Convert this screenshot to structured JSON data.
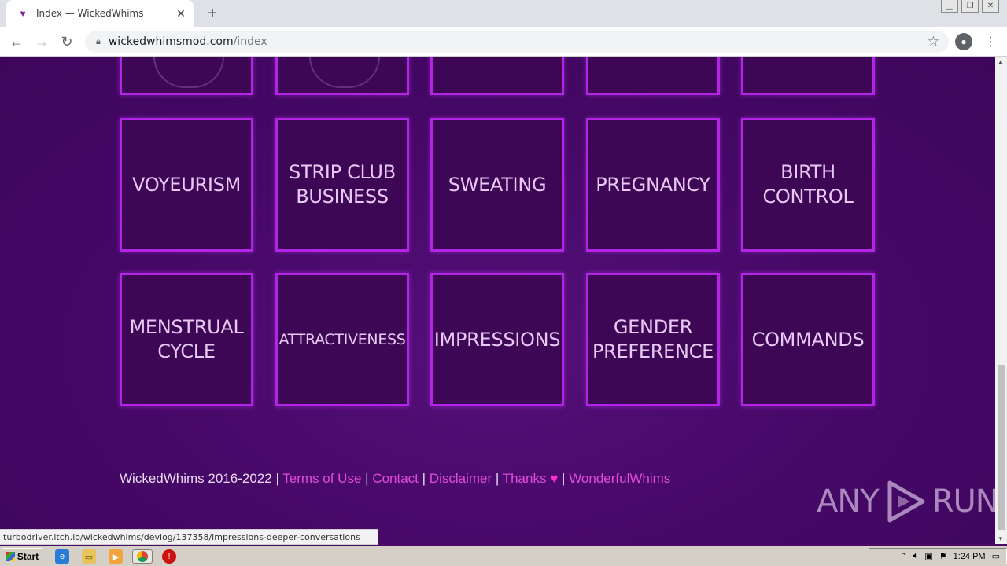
{
  "browser": {
    "tab_title": "Index — WickedWhims",
    "url_domain": "wickedwhimsmod.com",
    "url_path": "/index",
    "window_controls": [
      "▁",
      "❐",
      "✕"
    ]
  },
  "tiles_row2": [
    {
      "label": "VOYEURISM"
    },
    {
      "label": "STRIP CLUB\nBUSINESS"
    },
    {
      "label": "SWEATING"
    },
    {
      "label": "PREGNANCY"
    },
    {
      "label": "BIRTH\nCONTROL"
    }
  ],
  "tiles_row3": [
    {
      "label": "MENSTRUAL\nCYCLE"
    },
    {
      "label": "ATTRACTIVENESS"
    },
    {
      "label": "IMPRESSIONS"
    },
    {
      "label": "GENDER\nPREFERENCE"
    },
    {
      "label": "COMMANDS"
    }
  ],
  "footer": {
    "copyright": "WickedWhims 2016-2022",
    "links": [
      "Terms of Use",
      "Contact",
      "Disclaimer",
      "Thanks",
      "WonderfulWhims"
    ],
    "separator": "|"
  },
  "watermark": {
    "left": "ANY",
    "right": "RUN"
  },
  "status_url": "turbodriver.itch.io/wickedwhims/devlog/137358/impressions-deeper-conversations",
  "taskbar": {
    "start_label": "Start",
    "time": "1:24 PM"
  },
  "colors": {
    "tile_border": "#b424e6",
    "page_bg": "#4a0a66",
    "link": "#e24bd9"
  }
}
